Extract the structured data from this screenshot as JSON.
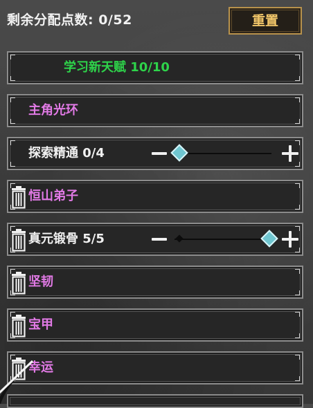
{
  "header": {
    "remaining_points": "剩余分配点数: 0/52"
  },
  "reset_button": {
    "label": "重置"
  },
  "rows": [
    {
      "label": "学习新天赋 10/10",
      "color": "#2ed34a",
      "removable": false,
      "slider": false
    },
    {
      "label": "主角光环",
      "color": "#e27ae6",
      "removable": false,
      "slider": false
    },
    {
      "label": "探索精通 0/4",
      "color": "#f0f0f0",
      "removable": false,
      "slider": true,
      "level": 0,
      "max": 4
    },
    {
      "label": "恒山弟子",
      "color": "#e27ae6",
      "removable": true,
      "slider": false
    },
    {
      "label": "真元锻骨 5/5",
      "color": "#f0f0f0",
      "removable": true,
      "slider": true,
      "level": 5,
      "max": 5
    },
    {
      "label": "坚韧",
      "color": "#e27ae6",
      "removable": true,
      "slider": false
    },
    {
      "label": "宝甲",
      "color": "#e27ae6",
      "removable": true,
      "slider": false
    },
    {
      "label": "幸运",
      "color": "#e27ae6",
      "removable": true,
      "slider": false
    }
  ],
  "icons": {
    "remove": "trash-icon",
    "decrease": "minus-icon",
    "increase": "plus-icon",
    "slider_handle": "diamond-icon"
  },
  "colors": {
    "accent_gold": "#f2c76a",
    "slider_knob": "#6fc6d0",
    "legendary_green": "#2ed34a",
    "epic_pink": "#e27ae6"
  }
}
